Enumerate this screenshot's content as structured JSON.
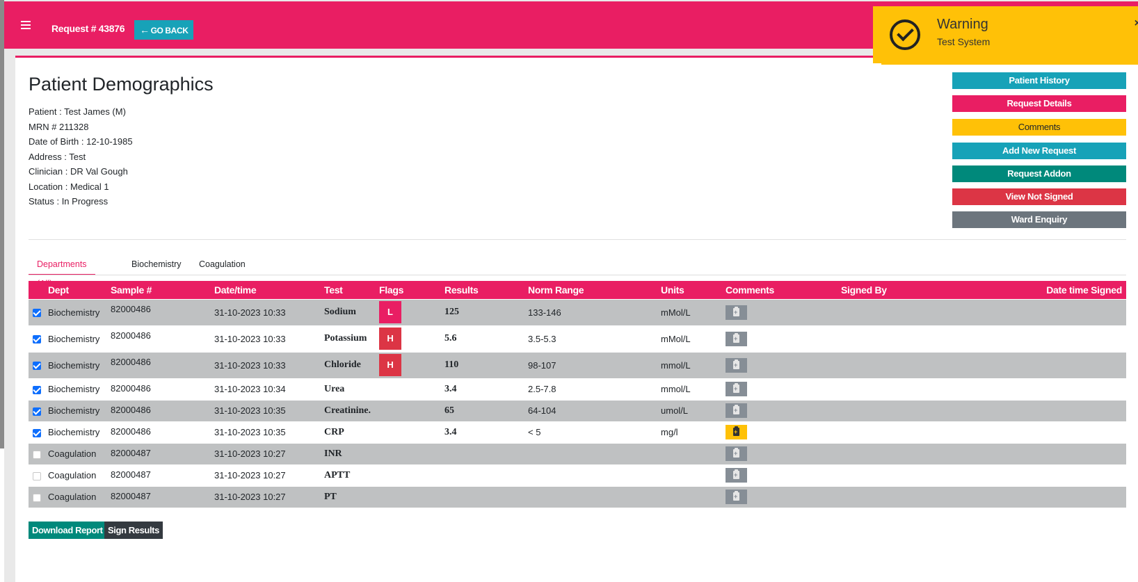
{
  "header": {
    "request_title": "Request # 43876",
    "go_back_label": "GO BACK",
    "menu_icon": "hamburger-menu-icon",
    "back_icon": "arrow-left-icon"
  },
  "toast": {
    "title": "Warning",
    "message": "Test System",
    "close_label": "×",
    "icon": "check-circle-icon"
  },
  "demographics": {
    "title": "Patient Demographics",
    "patient": "Patient : Test James (M)",
    "mrn": "MRN # 211328",
    "dob": "Date of Birth : 12-10-1985",
    "address": "Address : Test",
    "clinician": "Clinician : DR Val Gough",
    "location": "Location : Medical 1",
    "status": "Status : In Progress"
  },
  "side_buttons": {
    "patient_history": "Patient History",
    "request_details": "Request Details",
    "comments": "Comments",
    "add_new_request": "Add New Request",
    "request_addon": "Request Addon",
    "view_not_signed": "View Not Signed",
    "ward_enquiry": "Ward Enquiry"
  },
  "colors": {
    "primary": "#e91e63",
    "info": "#17a2b8",
    "warning": "#ffc107",
    "teal": "#00897b",
    "danger": "#dc3545",
    "secondary": "#6c757d",
    "dark": "#343a40"
  },
  "tabs": {
    "all": "Departments (All)",
    "biochemistry": "Biochemistry",
    "coagulation": "Coagulation"
  },
  "table": {
    "headers": {
      "dept": "Dept",
      "sample": "Sample #",
      "datetime": "Date/time",
      "test": "Test",
      "flags": "Flags",
      "results": "Results",
      "norm_range": "Norm Range",
      "units": "Units",
      "comments": "Comments",
      "signed_by": "Signed By",
      "date_signed": "Date time Signed"
    },
    "rows": [
      {
        "checked": true,
        "dept": "Biochemistry",
        "sample": "82000486",
        "datetime": "31-10-2023 10:33",
        "test": "Sodium",
        "flag": "L",
        "result": "125",
        "range": "133-146",
        "units": "mMol/L",
        "comment": false
      },
      {
        "checked": true,
        "dept": "Biochemistry",
        "sample": "82000486",
        "datetime": "31-10-2023 10:33",
        "test": "Potassium",
        "flag": "H",
        "result": "5.6",
        "range": "3.5-5.3",
        "units": "mMol/L",
        "comment": false
      },
      {
        "checked": true,
        "dept": "Biochemistry",
        "sample": "82000486",
        "datetime": "31-10-2023 10:33",
        "test": "Chloride",
        "flag": "H",
        "result": "110",
        "range": "98-107",
        "units": "mmol/L",
        "comment": false
      },
      {
        "checked": true,
        "dept": "Biochemistry",
        "sample": "82000486",
        "datetime": "31-10-2023 10:34",
        "test": "Urea",
        "flag": "",
        "result": "3.4",
        "range": "2.5-7.8",
        "units": "mmol/L",
        "comment": false
      },
      {
        "checked": true,
        "dept": "Biochemistry",
        "sample": "82000486",
        "datetime": "31-10-2023 10:35",
        "test": "Creatinine.",
        "flag": "",
        "result": "65",
        "range": "64-104",
        "units": "umol/L",
        "comment": false
      },
      {
        "checked": true,
        "dept": "Biochemistry",
        "sample": "82000486",
        "datetime": "31-10-2023 10:35",
        "test": "CRP",
        "flag": "",
        "result": "3.4",
        "range": "< 5",
        "units": "mg/l",
        "comment": true
      },
      {
        "checked": false,
        "dept": "Coagulation",
        "sample": "82000487",
        "datetime": "31-10-2023 10:27",
        "test": "INR",
        "flag": "",
        "result": "",
        "range": "",
        "units": "",
        "comment": false
      },
      {
        "checked": false,
        "dept": "Coagulation",
        "sample": "82000487",
        "datetime": "31-10-2023 10:27",
        "test": "APTT",
        "flag": "",
        "result": "",
        "range": "",
        "units": "",
        "comment": false
      },
      {
        "checked": false,
        "dept": "Coagulation",
        "sample": "82000487",
        "datetime": "31-10-2023 10:27",
        "test": "PT",
        "flag": "",
        "result": "",
        "range": "",
        "units": "",
        "comment": false
      }
    ]
  },
  "footer": {
    "download_report": "Download Report",
    "sign_results": "Sign Results"
  }
}
